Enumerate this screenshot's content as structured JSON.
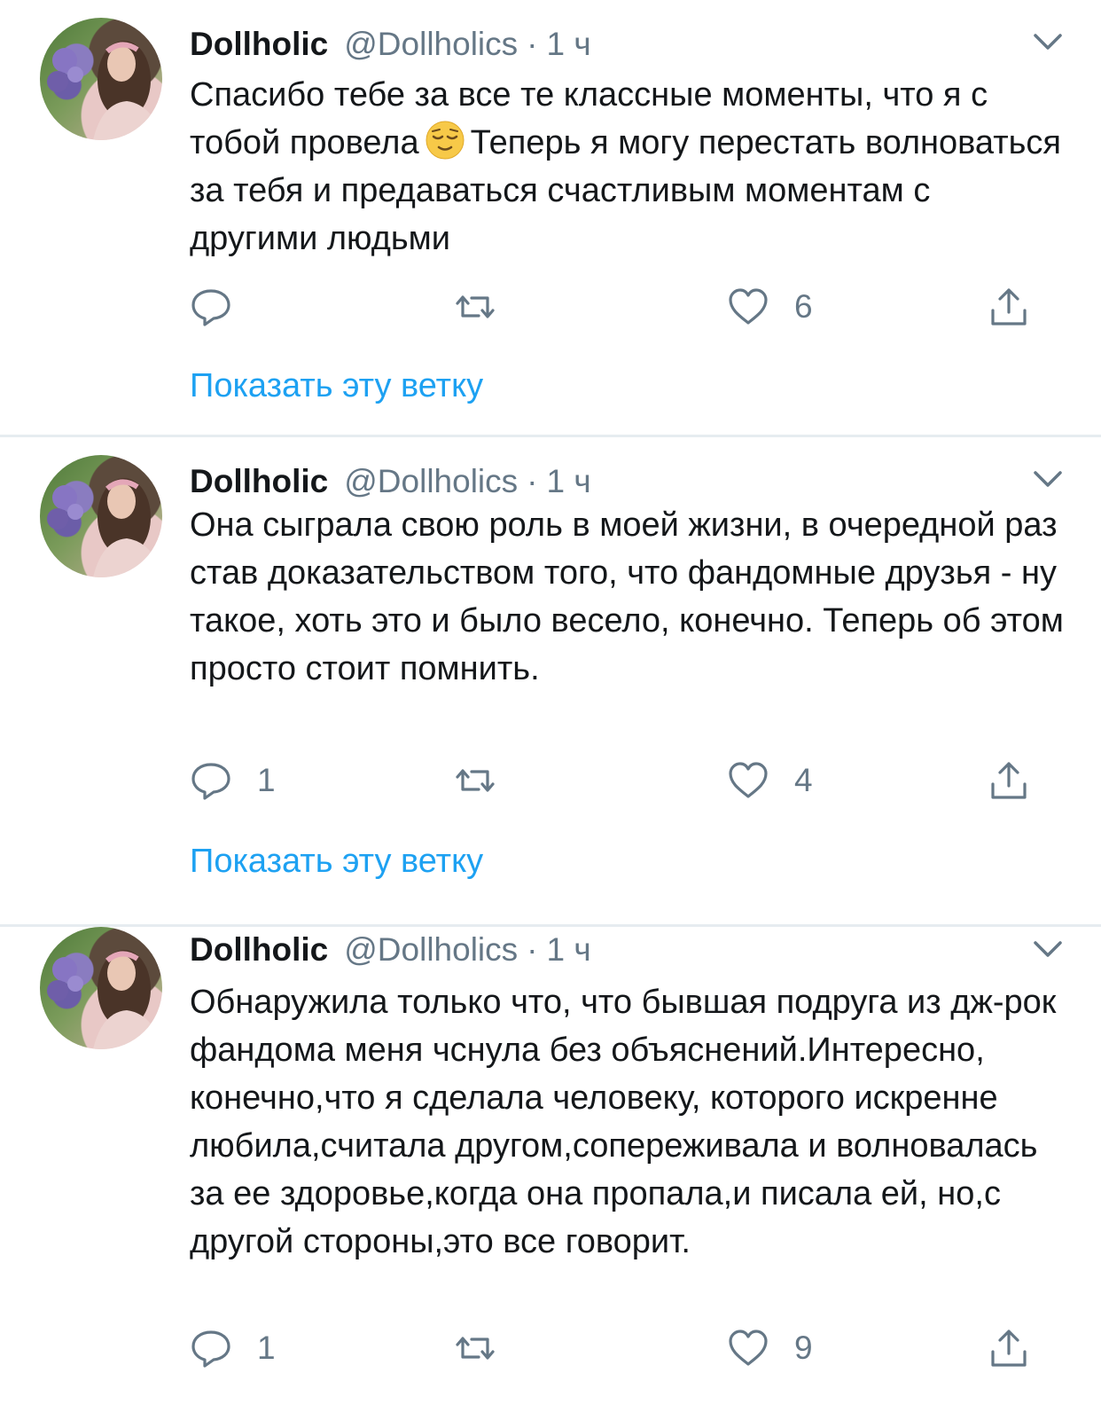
{
  "tweets": [
    {
      "author_name": "Dollholic",
      "author_handle": "@Dollholics",
      "separator": "·",
      "time": "1 ч",
      "text_before_emoji": "Спасибо тебе за все те классные моменты, что я с тобой провела",
      "emoji": "relieved-face",
      "text_after_emoji": "Теперь я могу перестать волноваться за тебя и предаваться счастливым моментам с другими людьми",
      "replies": "",
      "retweets": "",
      "likes": "6",
      "show_thread": "Показать эту ветку"
    },
    {
      "author_name": "Dollholic",
      "author_handle": "@Dollholics",
      "separator": "·",
      "time": "1 ч",
      "text": "Она сыграла свою роль в моей жизни, в очередной раз став доказательством того, что фандомные друзья - ну такое, хоть это и было весело, конечно. Теперь об этом просто стоит помнить.",
      "replies": "1",
      "retweets": "",
      "likes": "4",
      "show_thread": "Показать эту ветку"
    },
    {
      "author_name": "Dollholic",
      "author_handle": "@Dollholics",
      "separator": "·",
      "time": "1 ч",
      "text": "Обнаружила только что, что бывшая подруга из дж-рок фандома меня чснула без объяснений.Интересно, конечно,что я сделала человеку, которого искренне любила,считала другом,сопереживала и волновалась за ее здоровье,когда она пропала,и писала ей, но,с другой стороны,это все говорит.",
      "replies": "1",
      "retweets": "",
      "likes": "9"
    }
  ],
  "icons": {
    "reply": "reply-icon",
    "retweet": "retweet-icon",
    "like": "heart-icon",
    "share": "share-icon",
    "menu": "chevron-down-icon"
  },
  "colors": {
    "text": "#14171a",
    "secondary": "#657786",
    "link": "#1da1f2",
    "divider": "#e6ecf0"
  }
}
